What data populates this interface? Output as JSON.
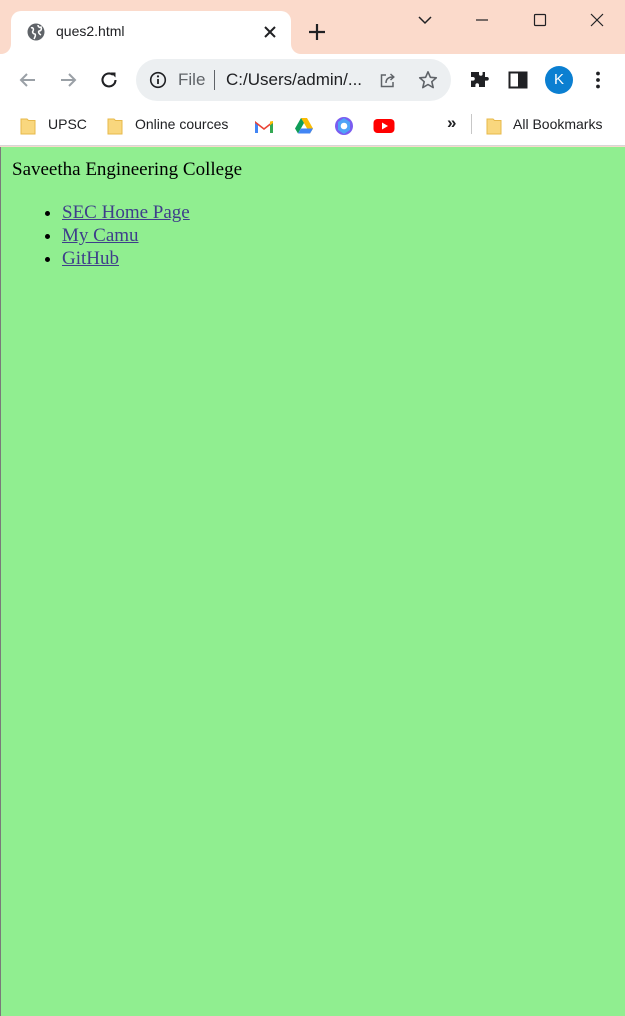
{
  "browser": {
    "tab": {
      "title": "ques2.html",
      "favicon": "globe-icon"
    },
    "window_controls": [
      "tab-search-icon",
      "minimize-icon",
      "maximize-icon",
      "close-icon"
    ],
    "omnibox": {
      "scheme_label": "File",
      "url": "C:/Users/admin/..."
    },
    "profile_initial": "K",
    "colors": {
      "titlebar": "#fbdacb",
      "profile": "#0b7fd1"
    }
  },
  "bookmarks": {
    "items": [
      {
        "label": "UPSC",
        "icon": "folder-icon"
      },
      {
        "label": "Online cources",
        "icon": "folder-icon"
      },
      {
        "label": "",
        "icon": "gmail-icon"
      },
      {
        "label": "",
        "icon": "google-drive-icon"
      },
      {
        "label": "",
        "icon": "copilot-icon"
      },
      {
        "label": "",
        "icon": "youtube-icon"
      }
    ],
    "overflow": "»",
    "all_bookmarks": "All Bookmarks"
  },
  "page": {
    "heading": "Saveetha Engineering College",
    "links": [
      {
        "label": "SEC Home Page"
      },
      {
        "label": "My Camu"
      },
      {
        "label": "GitHub"
      }
    ],
    "colors": {
      "background": "#90ee90",
      "link": "#3e3e8a"
    }
  }
}
